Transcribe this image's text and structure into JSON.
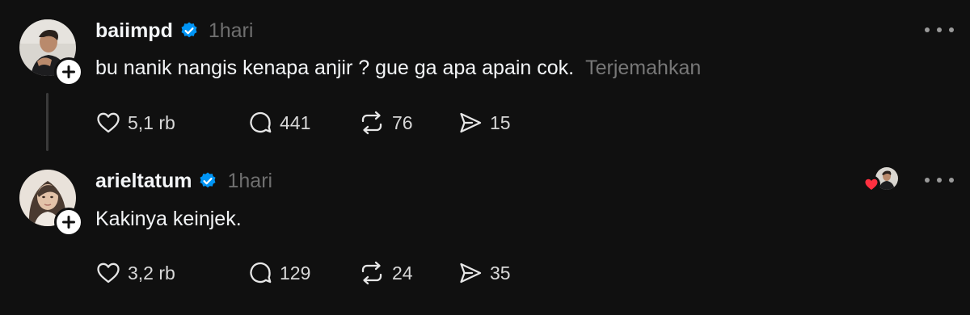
{
  "posts": [
    {
      "username": "baiimpd",
      "time": "1hari",
      "text": "bu nanik nangis kenapa anjir ? gue ga apa apain cok.",
      "translate_label": "Terjemahkan",
      "likes": "5,1 rb",
      "replies": "441",
      "reposts": "76",
      "shares": "15"
    },
    {
      "username": "arieltatum",
      "time": "1hari",
      "text": "Kakinya keinjek.",
      "likes": "3,2 rb",
      "replies": "129",
      "reposts": "24",
      "shares": "35"
    }
  ],
  "icons": {
    "verified": "verified-badge-icon",
    "follow": "plus-icon",
    "like": "heart-outline-icon",
    "reply": "speech-bubble-icon",
    "repost": "repost-arrows-icon",
    "share": "paper-plane-icon",
    "more": "more-horizontal-icon",
    "liked_by": "red-heart-icon"
  },
  "colors": {
    "background": "#101010",
    "text": "#f3f5f7",
    "muted": "#6f6f6f",
    "verified": "#0095f6",
    "heart": "#ff3040"
  }
}
